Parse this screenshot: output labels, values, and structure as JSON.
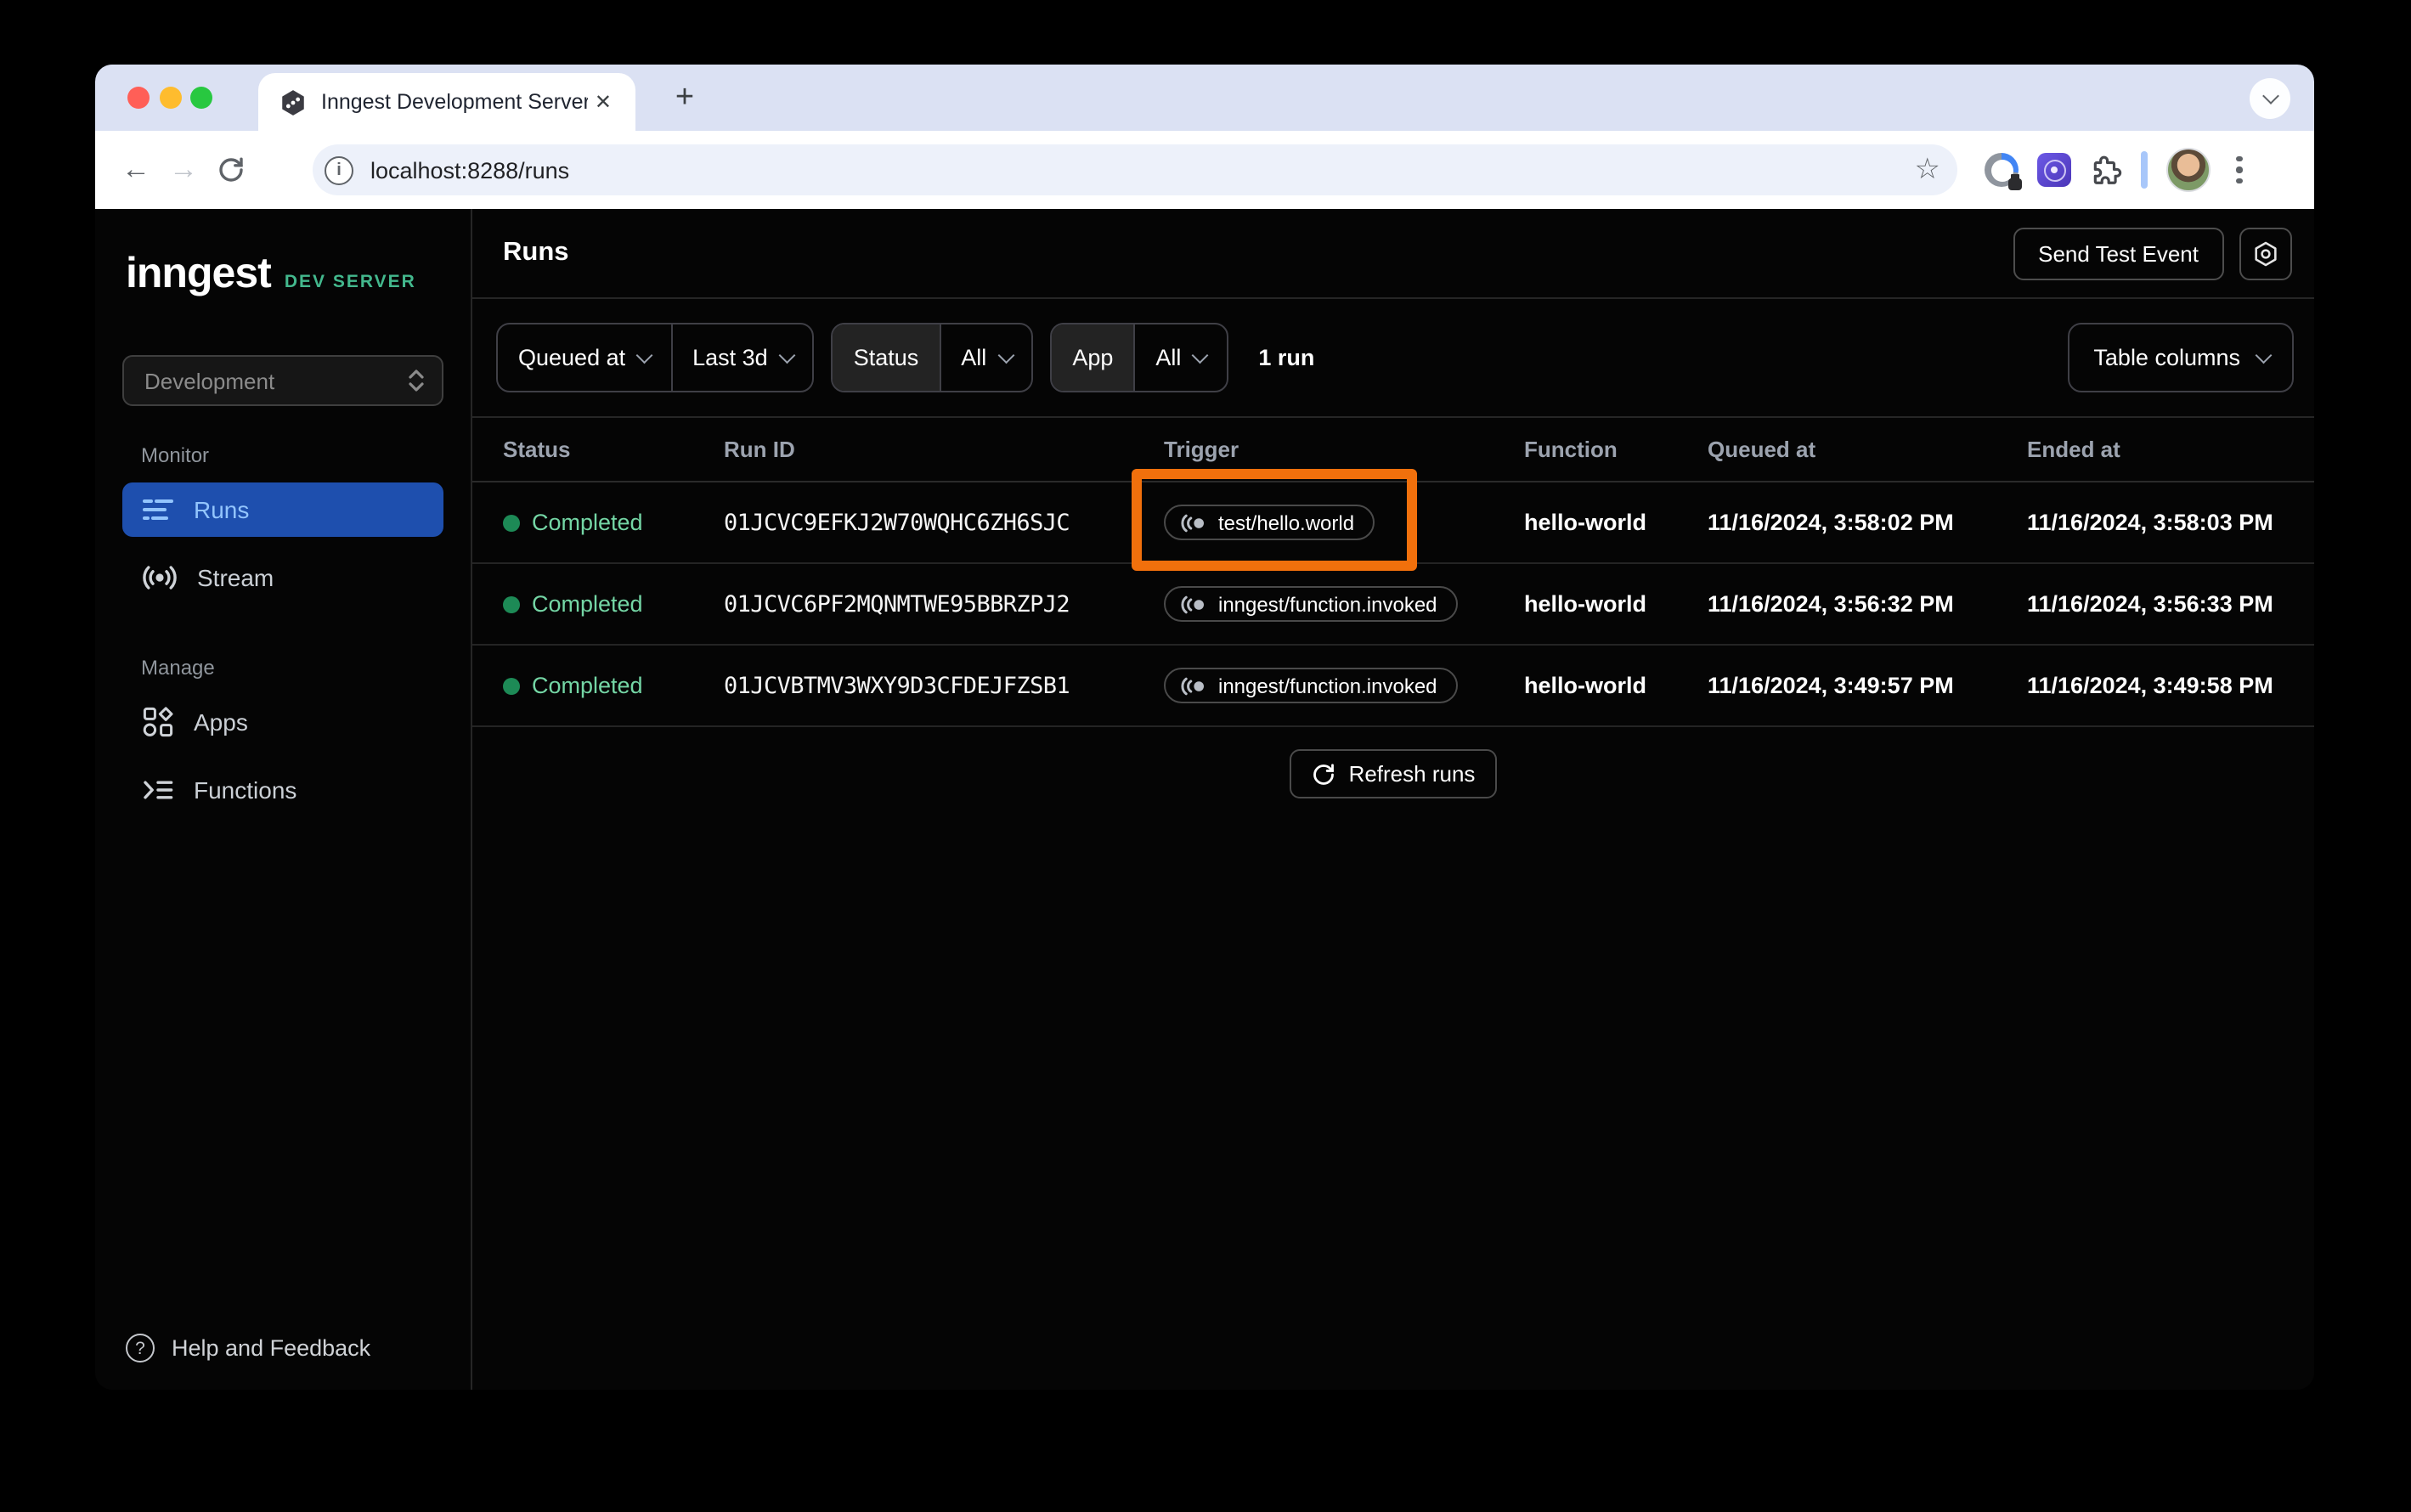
{
  "browser": {
    "tab_title": "Inngest Development Server",
    "url": "localhost:8288/runs"
  },
  "icons": {
    "close": "✕",
    "plus": "+",
    "back": "←",
    "forward": "→",
    "star": "☆",
    "help": "?",
    "info": "i"
  },
  "sidebar": {
    "logo": "inngest",
    "badge": "DEV SERVER",
    "env_selector": "Development",
    "monitor_label": "Monitor",
    "manage_label": "Manage",
    "items": {
      "runs": "Runs",
      "stream": "Stream",
      "apps": "Apps",
      "functions": "Functions"
    },
    "help_label": "Help and Feedback"
  },
  "header": {
    "title": "Runs",
    "send_test_event_label": "Send Test Event"
  },
  "filters": {
    "time_field": "Queued at",
    "time_range": "Last 3d",
    "status_label": "Status",
    "status_value": "All",
    "app_label": "App",
    "app_value": "All",
    "run_count": "1 run",
    "table_columns_label": "Table columns"
  },
  "table": {
    "columns": {
      "status": "Status",
      "run_id": "Run ID",
      "trigger": "Trigger",
      "function": "Function",
      "queued_at": "Queued at",
      "ended_at": "Ended at"
    },
    "rows": [
      {
        "status": "Completed",
        "run_id": "01JCVC9EFKJ2W70WQHC6ZH6SJC",
        "trigger": "test/hello.world",
        "function": "hello-world",
        "queued_at": "11/16/2024, 3:58:02 PM",
        "ended_at": "11/16/2024, 3:58:03 PM",
        "highlighted": true
      },
      {
        "status": "Completed",
        "run_id": "01JCVC6PF2MQNMTWE95BBRZPJ2",
        "trigger": "inngest/function.invoked",
        "function": "hello-world",
        "queued_at": "11/16/2024, 3:56:32 PM",
        "ended_at": "11/16/2024, 3:56:33 PM",
        "highlighted": false
      },
      {
        "status": "Completed",
        "run_id": "01JCVBTMV3WXY9D3CFDEJFZSB1",
        "trigger": "inngest/function.invoked",
        "function": "hello-world",
        "queued_at": "11/16/2024, 3:49:57 PM",
        "ended_at": "11/16/2024, 3:49:58 PM",
        "highlighted": false
      }
    ],
    "refresh_label": "Refresh runs"
  },
  "colors": {
    "highlight_orange": "#f1700c",
    "selected_nav_bg": "#1e4fae",
    "selected_nav_text": "#93c5fd",
    "dev_server_green": "#43b88d",
    "status_completed_text": "#74d6a5",
    "status_completed_dot": "#1d8a56",
    "tab_bar_bg": "#dbe1f3",
    "traffic_red": "#ff5f57",
    "traffic_yellow": "#febc2e",
    "traffic_green": "#28c840"
  }
}
